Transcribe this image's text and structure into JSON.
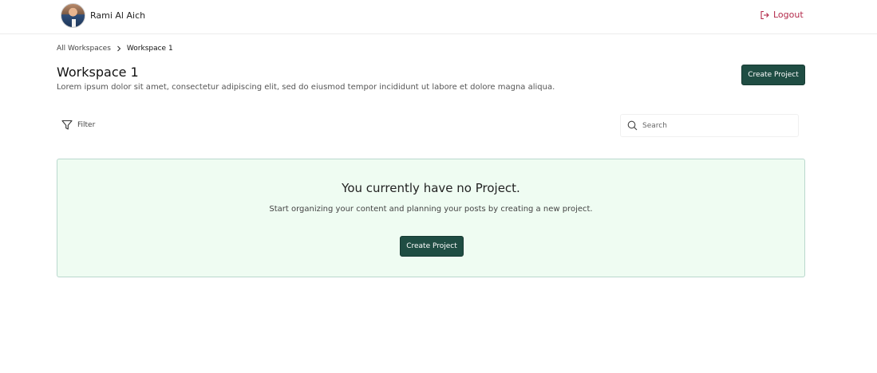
{
  "header": {
    "user_name": "Rami Al Aich",
    "logout_label": "Logout"
  },
  "breadcrumb": {
    "root": "All Workspaces",
    "current": "Workspace 1"
  },
  "page": {
    "title": "Workspace 1",
    "description": "Lorem ipsum dolor sit amet, consectetur adipiscing elit, sed do eiusmod tempor incididunt ut labore et dolore magna aliqua.",
    "create_button_label": "Create Project"
  },
  "toolbar": {
    "filter_label": "Filter",
    "search_placeholder": "Search"
  },
  "empty_state": {
    "title": "You currently have no Project.",
    "subtitle": "Start organizing your content and planning your posts by creating a new project.",
    "button_label": "Create Project"
  },
  "icons": {
    "logout": "logout-icon",
    "chevron": "chevron-right-icon",
    "filter": "filter-icon",
    "search": "search-icon"
  },
  "colors": {
    "primary": "#1f4d43",
    "logout": "#b3294a",
    "empty_bg": "#effcf2",
    "empty_border": "#b9d8cd"
  }
}
